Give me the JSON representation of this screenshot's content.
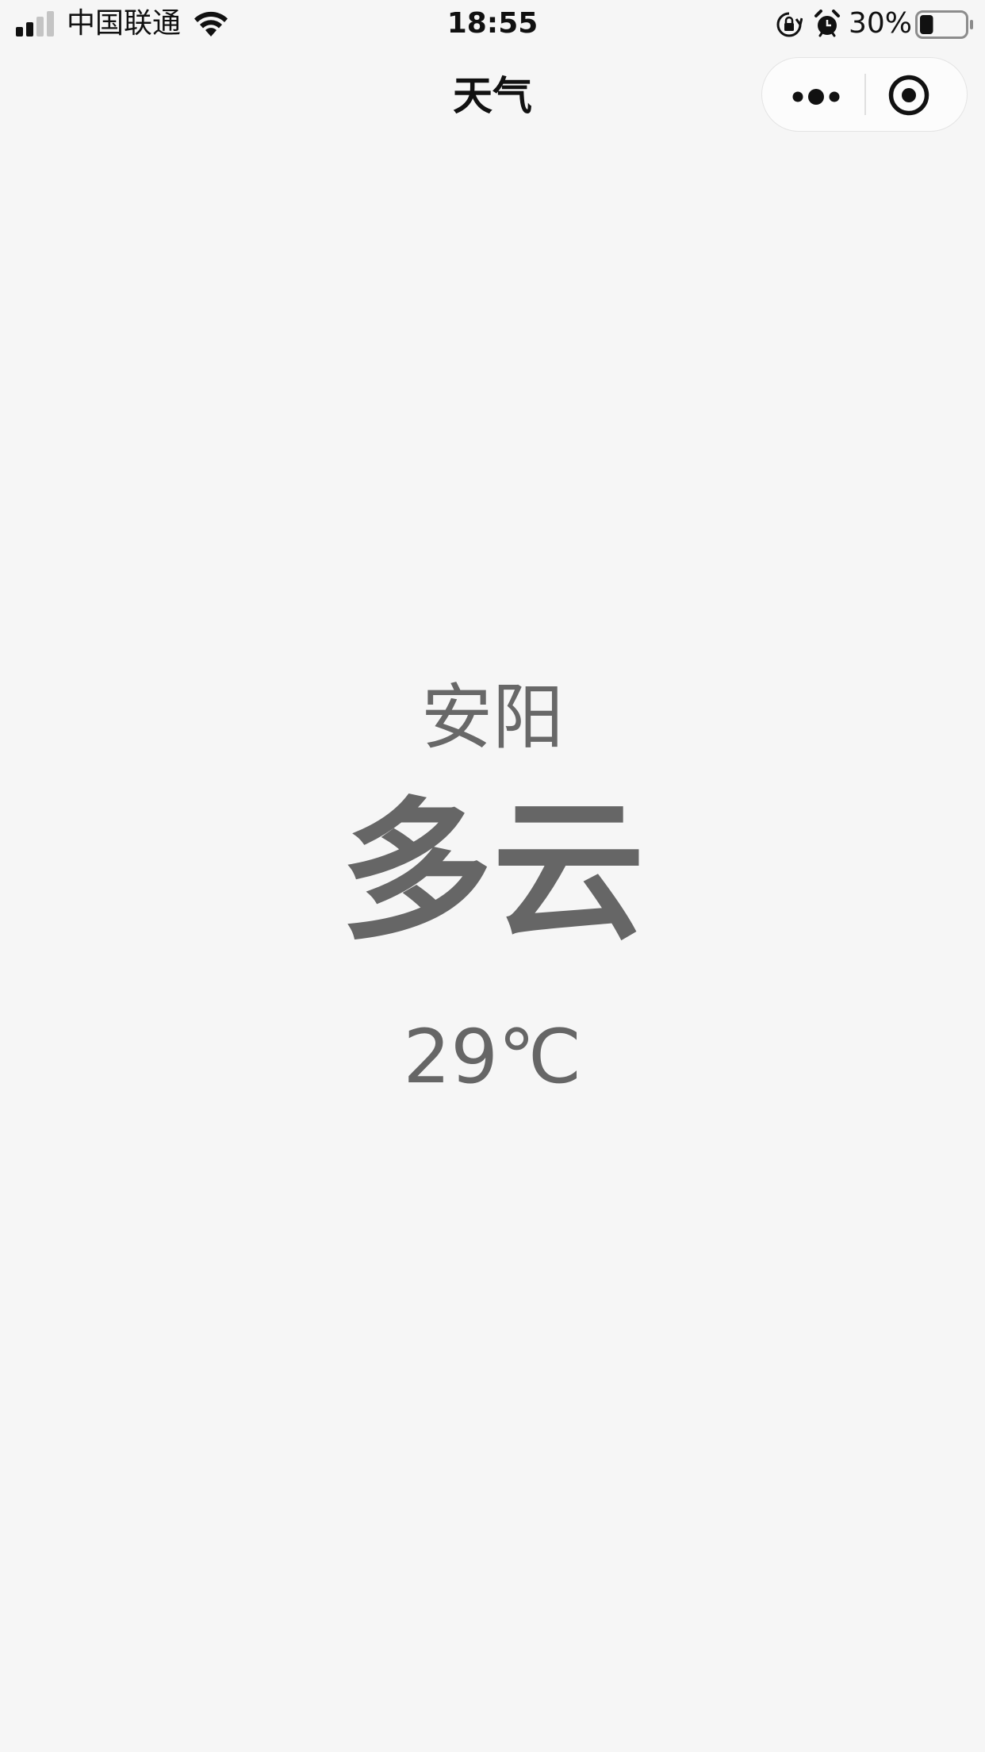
{
  "status_bar": {
    "carrier": "中国联通",
    "time": "18:55",
    "battery_percent": "30%",
    "battery_level": 0.3,
    "signal_bars_active": 2,
    "signal_bars_total": 4
  },
  "nav": {
    "title": "天气",
    "more_icon": "more-dots-icon",
    "close_icon": "target-circle-icon"
  },
  "weather": {
    "city": "安阳",
    "condition": "多云",
    "temperature": "29℃"
  },
  "colors": {
    "background": "#f6f6f6",
    "text_primary": "#111111",
    "text_weather": "#666666"
  }
}
